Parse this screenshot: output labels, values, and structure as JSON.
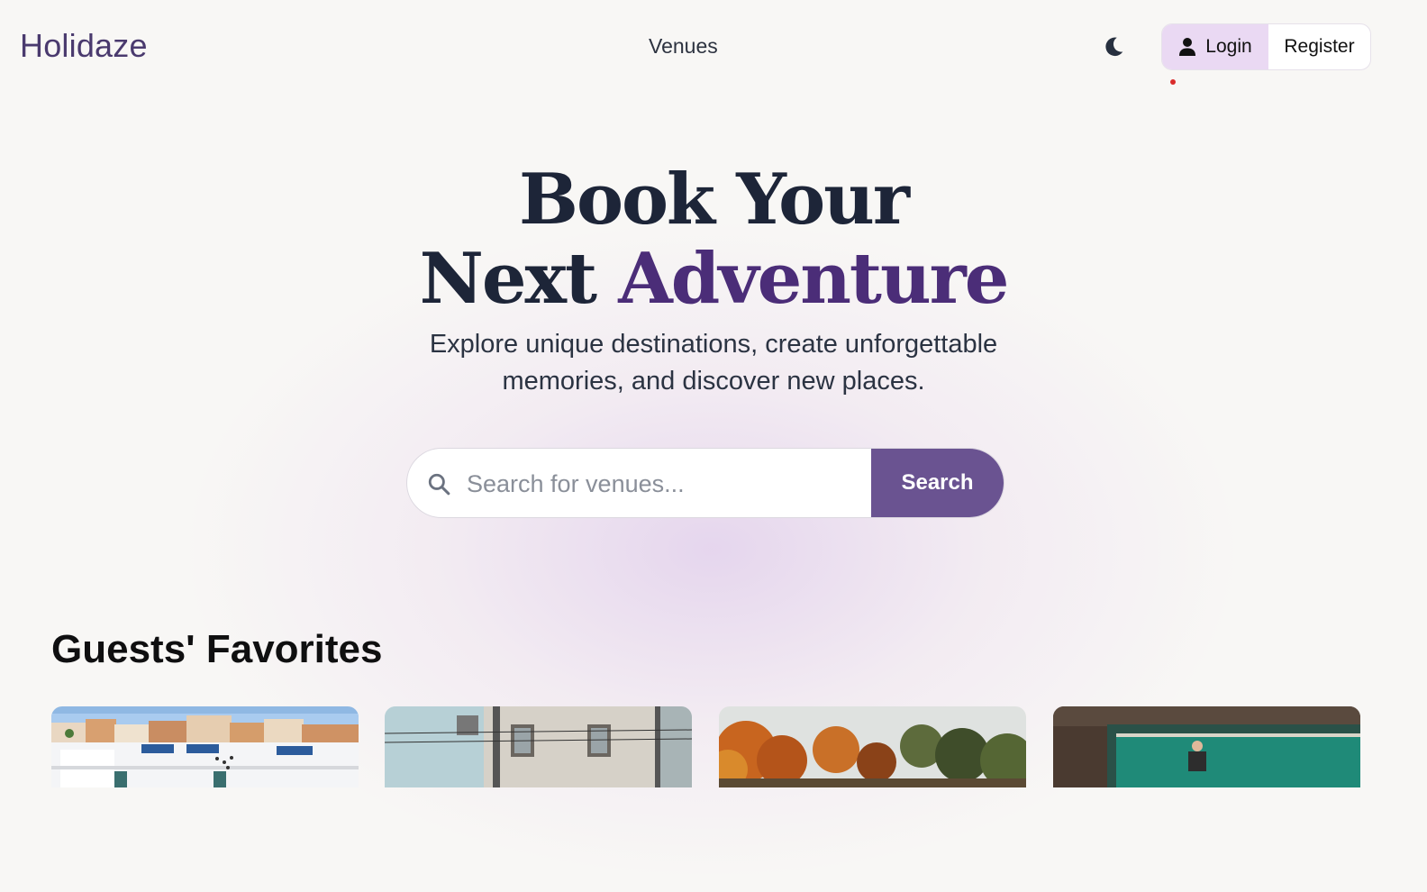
{
  "header": {
    "logo": "Holidaze",
    "nav_venues": "Venues",
    "login_label": "Login",
    "register_label": "Register",
    "theme_icon": "moon-icon",
    "user_icon": "user-icon"
  },
  "hero": {
    "title_line1": "Book Your",
    "title_line2_plain": "Next",
    "title_line2_accent": "Adventure",
    "subtitle": "Explore unique destinations, create unforgettable memories, and discover new places."
  },
  "search": {
    "placeholder": "Search for venues...",
    "button_label": "Search",
    "icon": "search-icon"
  },
  "favorites": {
    "title": "Guests' Favorites",
    "cards": [
      {
        "image": "coastal-town-image"
      },
      {
        "image": "street-building-image"
      },
      {
        "image": "autumn-trees-image"
      },
      {
        "image": "pool-aerial-image"
      }
    ]
  },
  "colors": {
    "brand": "#4a3a6e",
    "accent": "#4b2d78",
    "search_button": "#6a5391",
    "login_bg": "#ead9f3",
    "background": "#f8f7f5"
  }
}
